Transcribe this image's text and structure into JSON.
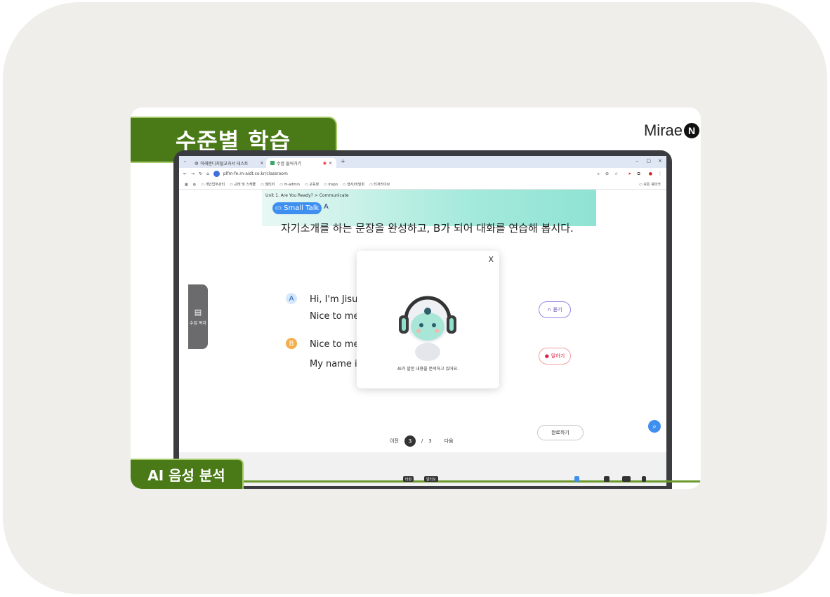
{
  "banner_top": "수준별 학습",
  "banner_bottom": "AI 음성 분석",
  "logo": {
    "text": "Mirae",
    "mark": "N"
  },
  "browser": {
    "tabs": [
      {
        "label": "미래엔디지털교과서 테스트"
      },
      {
        "label": "수업 들어가기"
      }
    ],
    "url": "plfm-fe.m-aidt.co.kr/classroom",
    "bookmarks": [
      "개인업무관리",
      "근태 및 스케줄",
      "엠티저",
      "m-admin",
      "교육청",
      "Inspo",
      "행사/비밀회",
      "티처라이브"
    ],
    "bookmarks_right": "모든 북마크"
  },
  "lesson": {
    "breadcrumb": "Unit 1. Are You Ready?  >  Communicate",
    "pill_label": "Small Talk",
    "pill_suffix": "A",
    "instruction": "자기소개를 하는 문장을 완성하고, B가 되어 대화를 연습해 봅시다."
  },
  "side_tab": "수업 목차",
  "dialogue": {
    "a_label": "A",
    "a_line1": "Hi, I'm Jisu.",
    "a_line2": "Nice to meet",
    "b_label": "B",
    "b_line1": "Nice to meet",
    "b_line2": "My name is"
  },
  "listen_button": "듣기",
  "speak_button": "말하기",
  "modal": {
    "close": "X",
    "message": "AI가 말한 내용을 분석하고 있어요."
  },
  "pager": {
    "prev": "이전",
    "current": "3",
    "sep": "/",
    "total": "3",
    "next": "다음"
  },
  "done_button": "완료하기",
  "taskbar_buttons": [
    "타원",
    "알리오"
  ],
  "colors": {
    "banner_green": "#4a7a17",
    "accent_blue": "#3f8ff0",
    "speak_red": "#e25555",
    "listen_purple": "#7a4fd0"
  }
}
